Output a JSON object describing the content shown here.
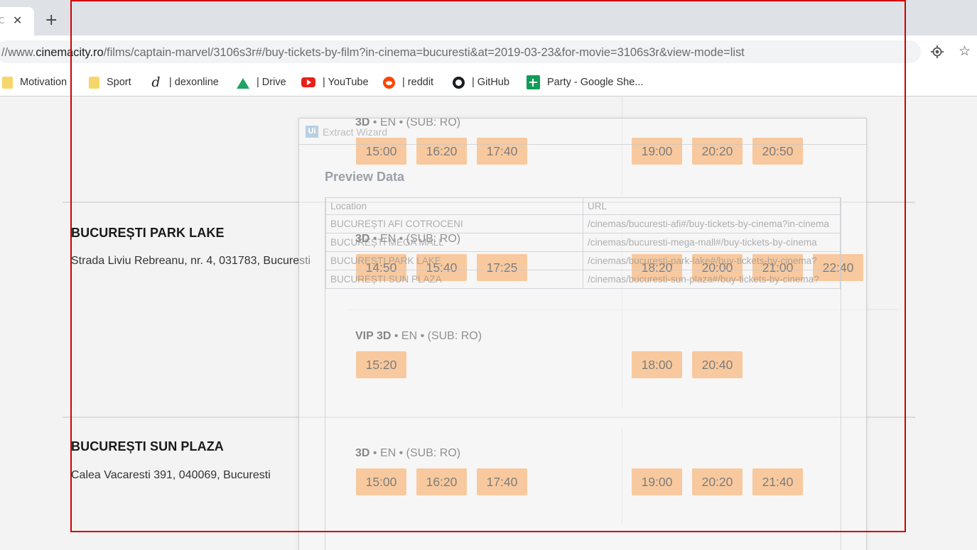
{
  "browser": {
    "tab": {
      "title": "C"
    },
    "url": {
      "prefix": "//www.",
      "host": "cinemacity.ro",
      "path": "/films/captain-marvel/3106s3r#/buy-tickets-by-film?in-cinema=bucuresti&at=2019-03-23&for-movie=3106s3r&view-mode=list"
    },
    "bookmarks": [
      {
        "label": "Motivation",
        "icon": "folder-icon"
      },
      {
        "label": "Sport",
        "icon": "folder-icon"
      },
      {
        "label": "| dexonline",
        "icon": "dexonline-icon",
        "glyph": "d"
      },
      {
        "label": "| Drive",
        "icon": "drive-icon"
      },
      {
        "label": "| YouTube",
        "icon": "youtube-icon"
      },
      {
        "label": "| reddit",
        "icon": "reddit-icon"
      },
      {
        "label": "| GitHub",
        "icon": "github-icon"
      },
      {
        "label": "Party - Google She...",
        "icon": "sheets-icon"
      }
    ]
  },
  "cinemas": [
    {
      "name": "",
      "address": "",
      "sessions": [
        {
          "format": "3D",
          "details": " • EN • (SUB:  RO)",
          "times_left": [
            "15:00",
            "16:20",
            "17:40"
          ],
          "times_right": [
            "19:00",
            "20:20",
            "20:50"
          ]
        }
      ]
    },
    {
      "name": "BUCUREȘTI PARK LAKE",
      "address": "Strada Liviu Rebreanu, nr. 4, 031783, Bucuresti",
      "sessions": [
        {
          "format": "3D",
          "details": " • EN • (SUB:  RO)",
          "times_left": [
            "14:50",
            "15:40",
            "17:25"
          ],
          "times_right": [
            "18:20",
            "20:00",
            "21:00",
            "22:40"
          ]
        },
        {
          "format": "VIP 3D",
          "details": " • EN • (SUB:  RO)",
          "times_left": [
            "15:20"
          ],
          "times_right": [
            "18:00",
            "20:40"
          ]
        }
      ]
    },
    {
      "name": "BUCUREȘTI SUN PLAZA",
      "address": "Calea Vacaresti 391, 040069, Bucuresti",
      "sessions": [
        {
          "format": "3D",
          "details": " • EN • (SUB:  RO)",
          "times_left": [
            "15:00",
            "16:20",
            "17:40"
          ],
          "times_right": [
            "19:00",
            "20:20",
            "21:40"
          ]
        }
      ]
    }
  ],
  "wizard": {
    "logo": "Ui",
    "title": "Extract Wizard",
    "preview_heading": "Preview Data",
    "columns": [
      "Location",
      "URL"
    ],
    "rows": [
      [
        "BUCUREȘTI AFI COTROCENI",
        "/cinemas/bucuresti-afi#/buy-tickets-by-cinema?in-cinema"
      ],
      [
        "BUCUREȘTI MEGA MALL",
        "/cinemas/bucuresti-mega-mall#/buy-tickets-by-cinema"
      ],
      [
        "BUCUREȘTI PARK LAKE",
        "/cinemas/bucuresti-park-lake#/buy-tickets-by-cinema?"
      ],
      [
        "BUCUREȘTI SUN PLAZA",
        "/cinemas/bucuresti-sun-plaza#/buy-tickets-by-cinema?"
      ]
    ]
  },
  "colors": {
    "showtime_button": "#f6a55c",
    "selection_frame": "#d20000"
  }
}
